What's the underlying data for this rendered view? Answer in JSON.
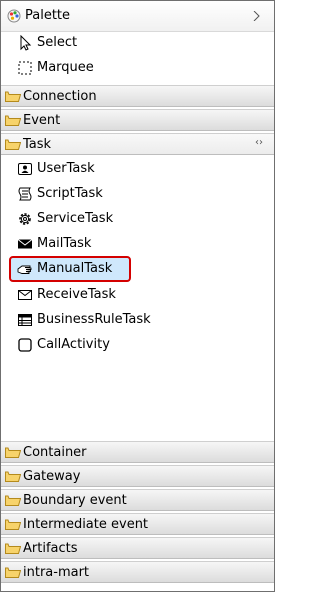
{
  "palette": {
    "title": "Palette"
  },
  "tools": [
    {
      "label": "Select",
      "icon": "cursor-arrow-icon"
    },
    {
      "label": "Marquee",
      "icon": "marquee-icon"
    }
  ],
  "drawers_top": [
    {
      "label": "Connection"
    },
    {
      "label": "Event"
    },
    {
      "label": "Task"
    }
  ],
  "tasks": [
    {
      "label": "UserTask",
      "icon": "user-task-icon"
    },
    {
      "label": "ScriptTask",
      "icon": "script-task-icon"
    },
    {
      "label": "ServiceTask",
      "icon": "gear-icon"
    },
    {
      "label": "MailTask",
      "icon": "mail-filled-icon"
    },
    {
      "label": "ManualTask",
      "icon": "hand-icon",
      "selected": true
    },
    {
      "label": "ReceiveTask",
      "icon": "envelope-icon"
    },
    {
      "label": "BusinessRuleTask",
      "icon": "table-icon"
    },
    {
      "label": "CallActivity",
      "icon": "rounded-box-icon"
    }
  ],
  "drawers_bottom": [
    {
      "label": "Container"
    },
    {
      "label": "Gateway"
    },
    {
      "label": "Boundary event"
    },
    {
      "label": "Intermediate event"
    },
    {
      "label": "Artifacts"
    },
    {
      "label": "intra-mart"
    }
  ],
  "colors": {
    "selection_bg": "#cfe8fc",
    "highlight_border": "#d40000",
    "folder": "#f0c04a"
  }
}
